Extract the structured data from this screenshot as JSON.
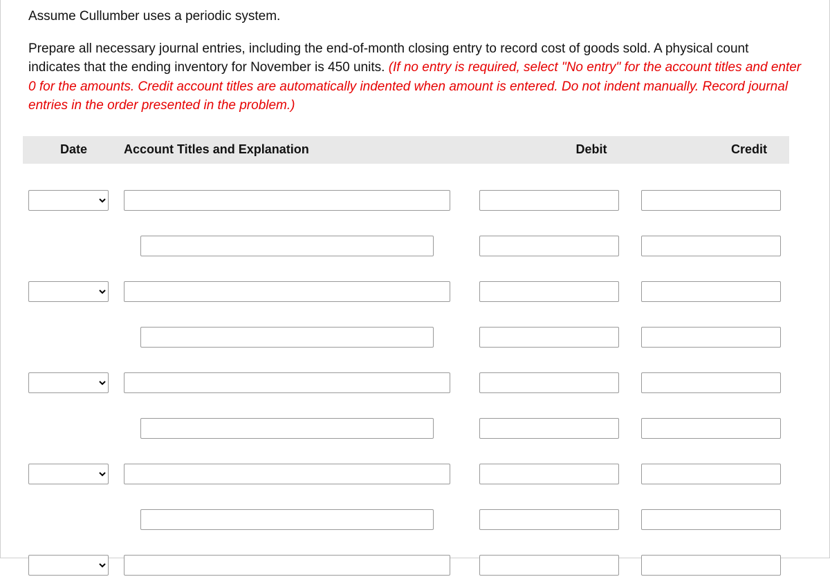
{
  "intro": {
    "line1": "Assume Cullumber uses a periodic system.",
    "line2_black": "Prepare all necessary journal entries, including the end-of-month closing entry to record cost of goods sold. A physical count indicates that the ending inventory for November is 450 units. ",
    "line2_red": "(If no entry is required, select \"No entry\" for the account titles and enter 0 for the amounts. Credit account titles are automatically indented when amount is entered. Do not indent manually. Record journal entries in the order presented in the problem.)"
  },
  "headers": {
    "date": "Date",
    "account": "Account Titles and Explanation",
    "debit": "Debit",
    "credit": "Credit"
  },
  "rows": [
    {
      "hasDate": true,
      "indent": false,
      "date": "",
      "account": "",
      "debit": "",
      "credit": ""
    },
    {
      "hasDate": false,
      "indent": true,
      "date": "",
      "account": "",
      "debit": "",
      "credit": ""
    },
    {
      "hasDate": true,
      "indent": false,
      "date": "",
      "account": "",
      "debit": "",
      "credit": ""
    },
    {
      "hasDate": false,
      "indent": true,
      "date": "",
      "account": "",
      "debit": "",
      "credit": ""
    },
    {
      "hasDate": true,
      "indent": false,
      "date": "",
      "account": "",
      "debit": "",
      "credit": ""
    },
    {
      "hasDate": false,
      "indent": true,
      "date": "",
      "account": "",
      "debit": "",
      "credit": ""
    },
    {
      "hasDate": true,
      "indent": false,
      "date": "",
      "account": "",
      "debit": "",
      "credit": ""
    },
    {
      "hasDate": false,
      "indent": true,
      "date": "",
      "account": "",
      "debit": "",
      "credit": ""
    },
    {
      "hasDate": true,
      "indent": false,
      "date": "",
      "account": "",
      "debit": "",
      "credit": ""
    }
  ]
}
